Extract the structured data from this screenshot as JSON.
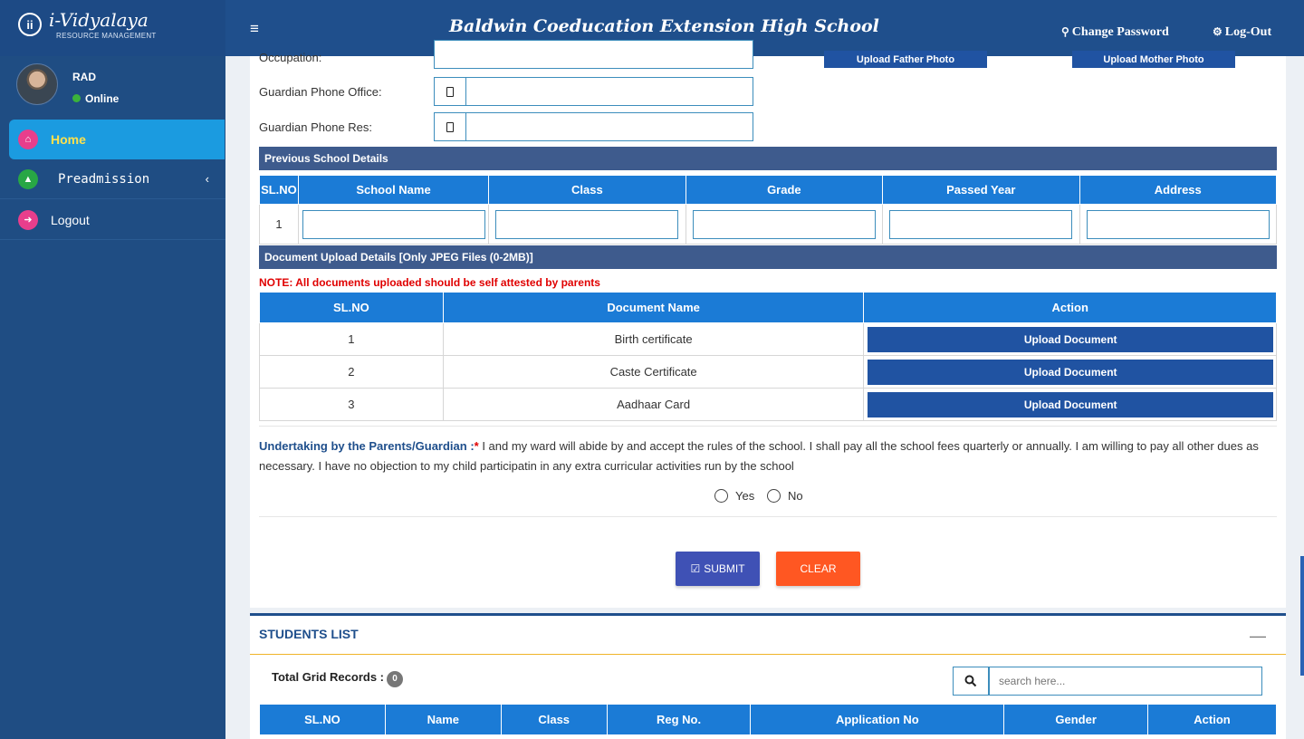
{
  "app": {
    "logo_title": "i-Vidyalaya",
    "logo_subtitle": "RESOURCE MANAGEMENT",
    "logo_badge": "ii",
    "school_name": "Baldwin Coeducation Extension High School",
    "change_password": "Change Password",
    "logout": "Log-Out"
  },
  "user": {
    "name": "RAD",
    "status": "Online"
  },
  "sidebar": {
    "items": [
      {
        "label": "Home",
        "icon": "home-icon",
        "color": "#e83e8c"
      },
      {
        "label": "Preadmission",
        "icon": "graduation-cap-icon",
        "color": "#28a745"
      },
      {
        "label": "Logout",
        "icon": "sign-out-icon",
        "color": "#e83e8c"
      }
    ]
  },
  "form": {
    "occupation_label": "Occupation:",
    "upload_father": "Upload Father Photo",
    "upload_mother": "Upload Mother Photo",
    "guardian_phone_office_label": "Guardian Phone Office:",
    "guardian_phone_res_label": "Guardian Phone Res:"
  },
  "previous_school": {
    "title": "Previous School Details",
    "headers": [
      "SL.NO",
      "School Name",
      "Class",
      "Grade",
      "Passed Year",
      "Address"
    ],
    "row_no": "1"
  },
  "documents": {
    "title": "Document Upload Details [Only JPEG Files (0-2MB)]",
    "note": "NOTE: All documents uploaded should be self attested by parents",
    "headers": [
      "SL.NO",
      "Document Name",
      "Action"
    ],
    "rows": [
      {
        "no": "1",
        "name": "Birth certificate",
        "action": "Upload Document"
      },
      {
        "no": "2",
        "name": "Caste Certificate",
        "action": "Upload Document"
      },
      {
        "no": "3",
        "name": "Aadhaar Card",
        "action": "Upload Document"
      }
    ]
  },
  "undertaking": {
    "label": "Undertaking by the Parents/Guardian :",
    "required": "*",
    "text": " I and my ward will abide by and accept the rules of the school. I shall pay all the school fees quarterly or annually. I am willing to pay all other dues as necessary. I have no objection to my child participatin in any extra curricular activities run by the school",
    "yes": "Yes",
    "no": "No"
  },
  "actions": {
    "submit": "SUBMIT",
    "clear": "CLEAR"
  },
  "students_list": {
    "title": "STUDENTS LIST",
    "total_label": "Total Grid Records :",
    "total_count": "0",
    "search_placeholder": "search here...",
    "headers": [
      "SL.NO",
      "Name",
      "Class",
      "Reg No.",
      "Application No",
      "Gender",
      "Action"
    ]
  }
}
